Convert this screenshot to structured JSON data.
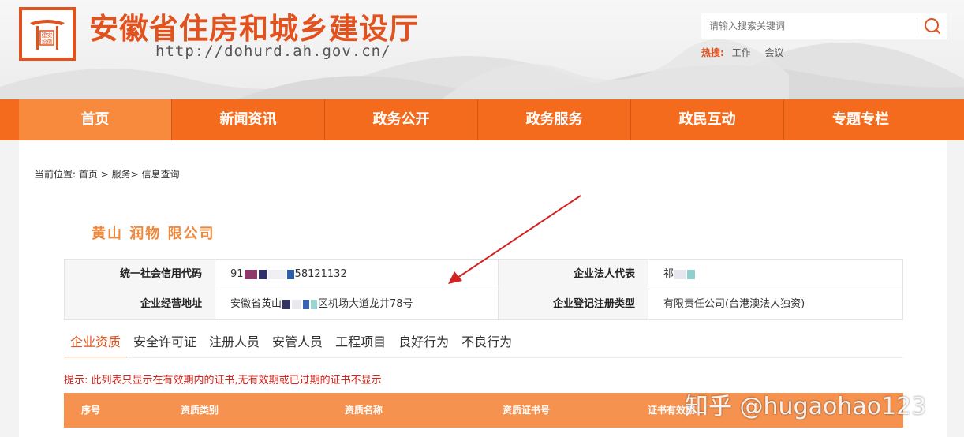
{
  "header": {
    "site_title": "安徽省住房和城乡建设厅",
    "site_url": "http://dohurd.ah.gov.cn/",
    "logo_text": "建安设徽",
    "search": {
      "placeholder": "请输入搜索关键词"
    },
    "hot": {
      "label": "热搜:",
      "items": [
        "工作",
        "会议"
      ]
    }
  },
  "nav": {
    "items": [
      {
        "label": "首页",
        "active": true
      },
      {
        "label": "新闻资讯"
      },
      {
        "label": "政务公开"
      },
      {
        "label": "政务服务"
      },
      {
        "label": "政民互动"
      },
      {
        "label": "专题专栏"
      }
    ]
  },
  "breadcrumb": {
    "prefix": "当前位置:",
    "items": [
      "首页",
      "服务",
      "信息查询"
    ],
    "separator": ">"
  },
  "company": {
    "name": "黄山 润物 限公司"
  },
  "info": {
    "credit_code_label": "统一社会信用代码",
    "credit_code_prefix": "91",
    "credit_code_suffix": "58121132",
    "legal_rep_label": "企业法人代表",
    "legal_rep_prefix": "祁",
    "address_label": "企业经营地址",
    "address_prefix": "安徽省黄山",
    "address_suffix": "区机场大道龙井78号",
    "reg_type_label": "企业登记注册类型",
    "reg_type_value": "有限责任公司(台港澳法人独资)"
  },
  "tabs": [
    {
      "label": "企业资质",
      "active": true
    },
    {
      "label": "安全许可证"
    },
    {
      "label": "注册人员"
    },
    {
      "label": "安管人员"
    },
    {
      "label": "工程项目"
    },
    {
      "label": "良好行为"
    },
    {
      "label": "不良行为"
    }
  ],
  "notice": "提示: 此列表只显示在有效期内的证书,无有效期或已过期的证书不显示",
  "table": {
    "headers": [
      "序号",
      "资质类别",
      "资质名称",
      "资质证书号",
      "证书有效期"
    ]
  },
  "watermark": "知乎 @hugaohao123",
  "colors": {
    "brand_orange": "#e2521f",
    "nav_bg": "#f56b1d",
    "nav_active": "#f78a3c",
    "table_head": "#f6924f",
    "notice_red": "#d6241c",
    "arrow_red": "#d32222"
  }
}
